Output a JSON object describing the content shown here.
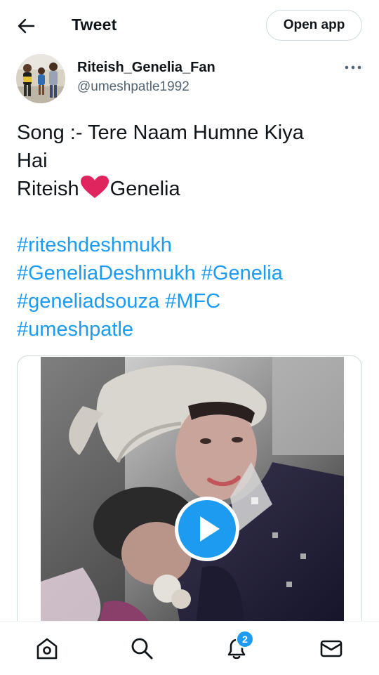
{
  "header": {
    "title": "Tweet",
    "open_app_label": "Open app",
    "back_icon": "arrow-left-icon"
  },
  "author": {
    "display_name": "Riteish_Genelia_Fan",
    "handle": "@umeshpatle1992",
    "more_icon": "more-horizontal-icon"
  },
  "tweet": {
    "line1": "Song :- Tere Naam Humne Kiya",
    "line2": "Hai",
    "name_left": "Riteish",
    "name_right": "Genelia",
    "hashtags": [
      "#riteshdeshmukh",
      "#GeneliaDeshmukh",
      "#Genelia",
      "#geneliadsouza",
      "#MFC",
      "#umeshpatle"
    ]
  },
  "media": {
    "type": "video",
    "play_icon": "play-icon"
  },
  "nav": {
    "notifications_badge": "2",
    "items": [
      "home-icon",
      "search-icon",
      "notifications-icon",
      "messages-icon"
    ]
  },
  "colors": {
    "accent": "#1d9bf0",
    "text": "#0f1419",
    "secondary": "#536471",
    "heart": "#e0245e"
  }
}
